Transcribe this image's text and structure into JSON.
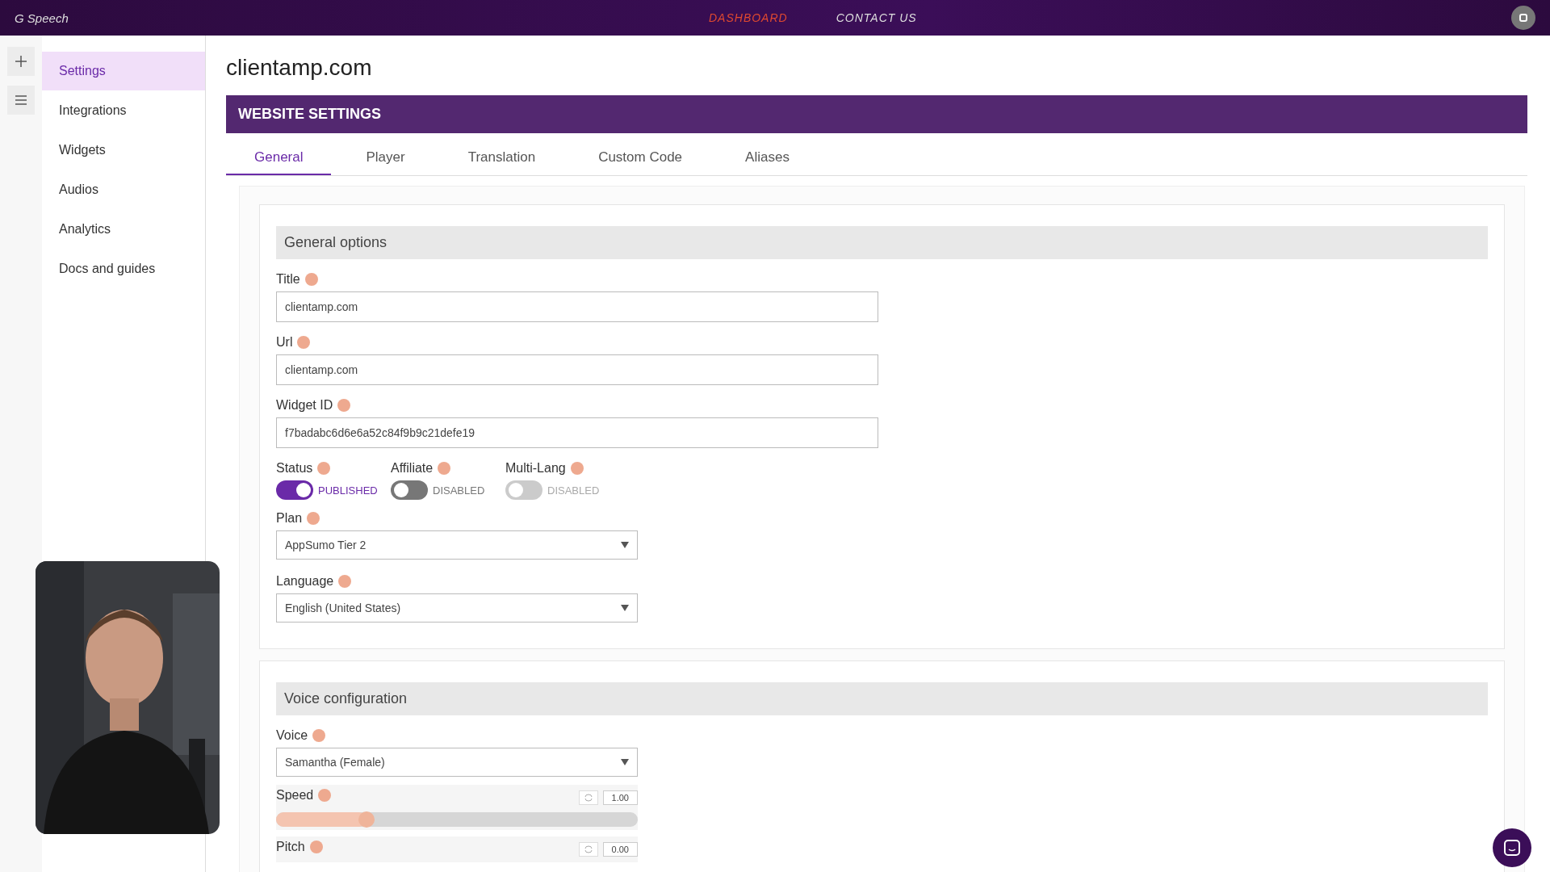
{
  "topbar": {
    "logo_mark": "G",
    "logo_text": "Speech",
    "nav": [
      {
        "label": "DASHBOARD",
        "selected": true
      },
      {
        "label": "CONTACT US",
        "selected": false
      }
    ]
  },
  "sidebar": {
    "items": [
      {
        "label": "Settings",
        "selected": true
      },
      {
        "label": "Integrations",
        "selected": false
      },
      {
        "label": "Widgets",
        "selected": false
      },
      {
        "label": "Audios",
        "selected": false
      },
      {
        "label": "Analytics",
        "selected": false
      },
      {
        "label": "Docs and guides",
        "selected": false
      }
    ]
  },
  "page_title": "clientamp.com",
  "header": "WEBSITE SETTINGS",
  "tabs": [
    {
      "label": "General",
      "selected": true
    },
    {
      "label": "Player",
      "selected": false
    },
    {
      "label": "Translation",
      "selected": false
    },
    {
      "label": "Custom Code",
      "selected": false
    },
    {
      "label": "Aliases",
      "selected": false
    }
  ],
  "general": {
    "title": "General options",
    "fields": [
      {
        "label": "Title",
        "value": "clientamp.com"
      },
      {
        "label": "Url",
        "value": "clientamp.com"
      },
      {
        "label": "Widget ID",
        "value": "f7badabc6d6e6a52c84f9b9c21defe19"
      }
    ],
    "toggles": [
      {
        "label": "Status",
        "on": true,
        "state": "PUBLISHED",
        "disabled": false
      },
      {
        "label": "Affiliate",
        "on": false,
        "state": "DISABLED",
        "disabled": false
      },
      {
        "label": "Multi-Lang",
        "on": false,
        "state": "DISABLED",
        "disabled": true
      }
    ],
    "selects": [
      {
        "label": "Plan",
        "value": "AppSumo Tier 2"
      },
      {
        "label": "Language",
        "value": "English (United States)"
      }
    ]
  },
  "voice": {
    "title": "Voice configuration",
    "select": {
      "label": "Voice",
      "value": "Samantha (Female)"
    },
    "sliders": [
      {
        "label": "Speed",
        "reading": "1.00",
        "level": 0.25
      },
      {
        "label": "Pitch",
        "reading": "0.00"
      }
    ]
  }
}
